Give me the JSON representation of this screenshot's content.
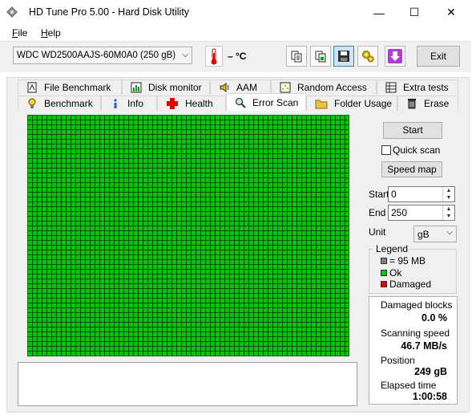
{
  "window": {
    "title": "HD Tune Pro 5.00 - Hard Disk Utility",
    "minimize": "—",
    "maximize": "☐",
    "close": "✕"
  },
  "menu": {
    "file_first": "F",
    "file_rest": "ile",
    "help_first": "H",
    "help_rest": "elp"
  },
  "toolbar": {
    "drive": "WDC WD2500AAJS-60M0A0 (250 gB)",
    "drive_arrow": "⌵",
    "temperature": "– °C",
    "exit_label": "Exit",
    "icons": [
      "copy-text-icon",
      "copy-screenshot-icon",
      "save-icon",
      "options-icon",
      "download-icon"
    ]
  },
  "tabs_back": [
    {
      "label": "File Benchmark",
      "icon": "file-benchmark-icon"
    },
    {
      "label": "Disk monitor",
      "icon": "disk-monitor-icon"
    },
    {
      "label": "AAM",
      "icon": "speaker-icon"
    },
    {
      "label": "Random Access",
      "icon": "random-access-icon"
    },
    {
      "label": "Extra tests",
      "icon": "extra-tests-icon"
    }
  ],
  "tabs_front": [
    {
      "label": "Benchmark",
      "icon": "lightbulb-icon"
    },
    {
      "label": "Info",
      "icon": "info-icon"
    },
    {
      "label": "Health",
      "icon": "health-cross-icon"
    },
    {
      "label": "Error Scan",
      "icon": "magnifier-icon",
      "active": true
    },
    {
      "label": "Folder Usage",
      "icon": "folder-icon"
    },
    {
      "label": "Erase",
      "icon": "trash-icon"
    }
  ],
  "scan": {
    "start_label": "Start",
    "quick_scan_label": "Quick scan",
    "quick_scan_checked": false,
    "speed_map_label": "Speed map",
    "start_field_label": "Start",
    "start_value": "0",
    "end_field_label": "End",
    "end_value": "250",
    "unit_label": "Unit",
    "unit_value": "gB",
    "grid_color": "#00c800"
  },
  "legend": {
    "title": "Legend",
    "items": [
      {
        "label": "= 95 MB",
        "color": "#808080"
      },
      {
        "label": "Ok",
        "color": "#00c800"
      },
      {
        "label": "Damaged",
        "color": "#e00000"
      }
    ]
  },
  "stats": {
    "damaged_label": "Damaged blocks",
    "damaged_value": "0.0 %",
    "speed_label": "Scanning speed",
    "speed_value": "46.7 MB/s",
    "position_label": "Position",
    "position_value": "249 gB",
    "elapsed_label": "Elapsed time",
    "elapsed_value": "1:00:58"
  }
}
